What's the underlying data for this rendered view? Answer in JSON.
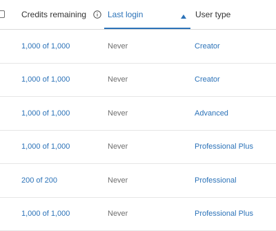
{
  "header": {
    "credits_label": "Credits remaining",
    "last_login_label": "Last login",
    "user_type_label": "User type"
  },
  "rows": [
    {
      "credits": "1,000 of 1,000",
      "last_login": "Never",
      "user_type": "Creator"
    },
    {
      "credits": "1,000 of 1,000",
      "last_login": "Never",
      "user_type": "Creator"
    },
    {
      "credits": "1,000 of 1,000",
      "last_login": "Never",
      "user_type": "Advanced"
    },
    {
      "credits": "1,000 of 1,000",
      "last_login": "Never",
      "user_type": "Professional Plus"
    },
    {
      "credits": "200 of 200",
      "last_login": "Never",
      "user_type": "Professional"
    },
    {
      "credits": "1,000 of 1,000",
      "last_login": "Never",
      "user_type": "Professional Plus"
    }
  ],
  "colors": {
    "accent": "#2b72b8",
    "text": "#323232",
    "muted": "#6e6e6e",
    "divider": "#e6e6e6"
  },
  "sort": {
    "column": "last_login",
    "direction": "ascending"
  }
}
